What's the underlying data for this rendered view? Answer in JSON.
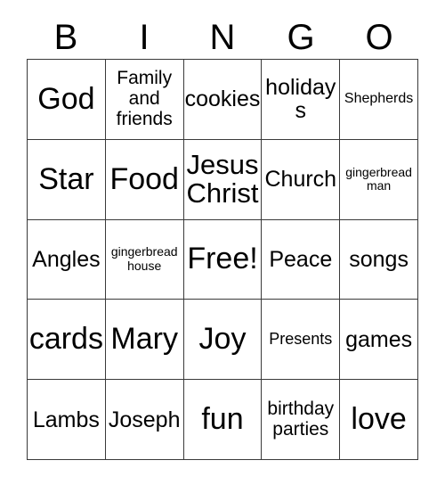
{
  "card": {
    "title_letters": [
      "B",
      "I",
      "N",
      "G",
      "O"
    ],
    "grid": {
      "columns": 5,
      "rows": 5,
      "border_color": "#3a3a3a",
      "background": "#ffffff",
      "text_color": "#000000",
      "cells": [
        {
          "text": "God",
          "size": "s-xl"
        },
        {
          "text": "Family and friends",
          "size": "s-sm"
        },
        {
          "text": "cookies",
          "size": "s-md"
        },
        {
          "text": "holidays",
          "size": "s-md"
        },
        {
          "text": "Shepherds",
          "size": "s-xxs"
        },
        {
          "text": "Star",
          "size": "s-xl"
        },
        {
          "text": "Food",
          "size": "s-xl"
        },
        {
          "text": "Jesus Christ",
          "size": "s-lg"
        },
        {
          "text": "Church",
          "size": "s-md"
        },
        {
          "text": "gingerbread man",
          "size": "s-tiny"
        },
        {
          "text": "Angles",
          "size": "s-md"
        },
        {
          "text": "gingerbread house",
          "size": "s-tiny"
        },
        {
          "text": "Free!",
          "size": "s-xl"
        },
        {
          "text": "Peace",
          "size": "s-md"
        },
        {
          "text": "songs",
          "size": "s-md"
        },
        {
          "text": "cards",
          "size": "s-xl"
        },
        {
          "text": "Mary",
          "size": "s-xl"
        },
        {
          "text": "Joy",
          "size": "s-xl"
        },
        {
          "text": "Presents",
          "size": "s-xs"
        },
        {
          "text": "games",
          "size": "s-md"
        },
        {
          "text": "Lambs",
          "size": "s-md"
        },
        {
          "text": "Joseph",
          "size": "s-md"
        },
        {
          "text": "fun",
          "size": "s-xl"
        },
        {
          "text": "birthday parties",
          "size": "s-sm"
        },
        {
          "text": "love",
          "size": "s-xl"
        }
      ]
    }
  }
}
